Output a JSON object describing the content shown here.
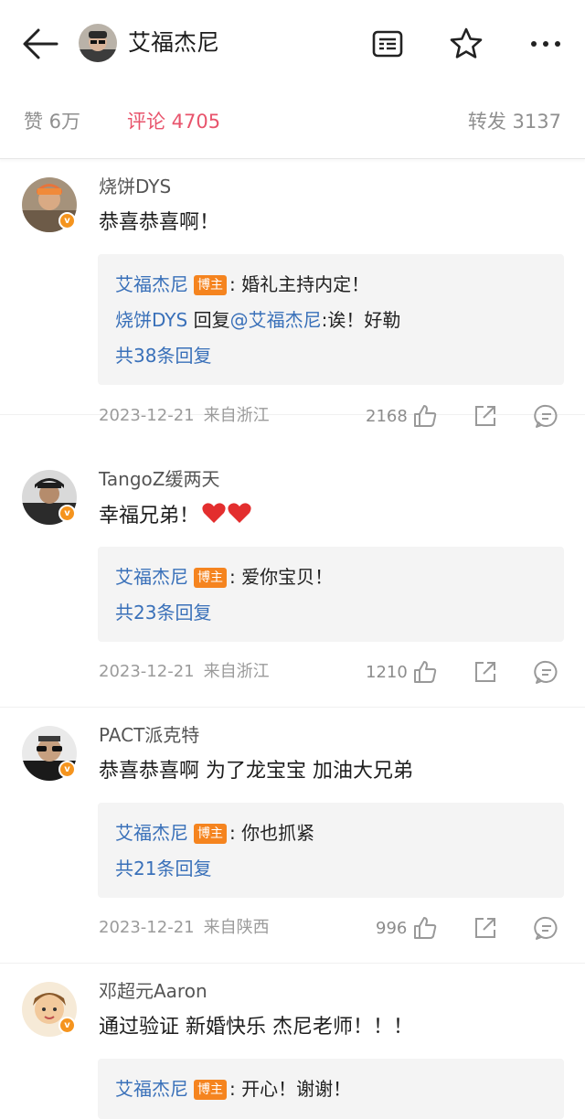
{
  "header": {
    "title": "艾福杰尼",
    "icons": [
      "arrow-left-icon",
      "article-icon",
      "star-icon",
      "more-icon"
    ]
  },
  "tabs": [
    {
      "label": "赞 6万"
    },
    {
      "label": "评论 4705"
    },
    {
      "label": "转发 3137"
    }
  ],
  "colors": {
    "accent": "#e8546c",
    "link": "#3970b9",
    "badge": "#f5841f"
  },
  "comments": [
    {
      "user": "烧饼DYS",
      "text": "恭喜恭喜啊！",
      "replies": [
        {
          "author": "艾福杰尼",
          "badge": "博主",
          "text": ": 婚礼主持内定！"
        },
        {
          "author": "烧饼DYS",
          "mid": " 回复",
          "mention": "@艾福杰尼",
          "text": ":诶！好勒"
        }
      ],
      "more": "共38条回复",
      "date": "2023-12-21",
      "location": "来自浙江",
      "likes": "2168"
    },
    {
      "user": "TangoZ缓两天",
      "text": "幸福兄弟！",
      "replies": [
        {
          "author": "艾福杰尼",
          "badge": "博主",
          "text": ": 爱你宝贝！"
        }
      ],
      "more": "共23条回复",
      "date": "2023-12-21",
      "location": "来自浙江",
      "likes": "1210"
    },
    {
      "user": "PACT派克特",
      "text": "恭喜恭喜啊 为了龙宝宝 加油大兄弟",
      "replies": [
        {
          "author": "艾福杰尼",
          "badge": "博主",
          "text": ": 你也抓紧"
        }
      ],
      "more": "共21条回复",
      "date": "2023-12-21",
      "location": "来自陕西",
      "likes": "996"
    },
    {
      "user": "邓超元Aaron",
      "text": "通过验证 新婚快乐 杰尼老师！！！",
      "replies": [
        {
          "author": "艾福杰尼",
          "badge": "博主",
          "text": ": 开心！谢谢！"
        }
      ]
    }
  ]
}
